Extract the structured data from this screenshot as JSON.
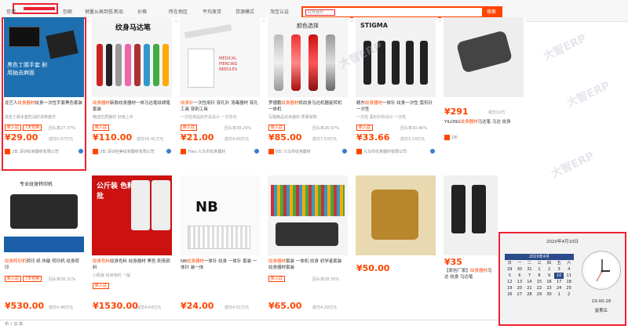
{
  "filters": {
    "items": [
      "信用",
      "包邮",
      "销量从高到低",
      "新品",
      "价格",
      "所在地区",
      "平均发货",
      "货源模式",
      "淘宝认证"
    ],
    "search_placeholder": "纹身器材",
    "search_button": "搜索"
  },
  "products": [
    {
      "title_a": "龙艺人",
      "title_hl": "纹身器材",
      "title_b": "纹身一次性手套黑色套装",
      "sub": "黑色丁腈手套防油防渗牌套件",
      "tags": [
        "新入驻",
        "7天包换"
      ],
      "rate": "回头率27.37%",
      "price": "¥29.00",
      "sold": "成交5.97万元",
      "shop": "2年 深圳纹身器材有限公司",
      "thumb_text": "黑色丁腈手套 耐用抽去麻面"
    },
    {
      "title_a": "",
      "title_hl": "纹身器材",
      "title_b": "新款纹身器材一体马达笔纹绣笔 套装",
      "sub": "精选优质器材 好用上手",
      "tags": [
        "新入驻"
      ],
      "rate": "",
      "price": "¥110.00",
      "sold": "成交16.41万元",
      "shop": "3年 深圳佳美纹身器材有限公司",
      "thumb_text": "纹身马达笔"
    },
    {
      "title_a": "",
      "title_hl": "纹身针",
      "title_b": "一次性用针 穿孔针 消毒器材 穿孔工具 穿刺工具",
      "sub": "一次性用品的开关设计 一次性也",
      "tags": [
        "新入驻"
      ],
      "rate": "回头率39.29%",
      "price": "¥21.00",
      "sold": "成交4.66万元",
      "shop": "Yiwu 义乌市纹身器材",
      "thumb_text": "MEDICAL PIERCING NEEDLES"
    },
    {
      "title_a": "罗德鹏",
      "title_hl": "纹身器材",
      "title_b": "机纹身马达机器旋转机 一体机",
      "sub": "写稿精品纹身器材 质量保障",
      "tags": [
        "新入驻"
      ],
      "rate": "回头率26.97%",
      "price": "¥85.00",
      "sold": "成交7.63万元",
      "shop": "8年 义乌市纹身器材",
      "thumb_text": "颜色选择"
    },
    {
      "title_a": "精东",
      "title_hl": "纹身器材",
      "title_b": "一体针 纹身一次性 弧形针 一次性",
      "sub": "一次性 弧形针的设计 一次性",
      "tags": [
        "新入驻"
      ],
      "rate": "回头率30.46%",
      "price": "¥33.66",
      "sold": "成交3.14万元",
      "shop": "义乌市纹身器材有限公司",
      "thumb_text": "STIGMA"
    },
    {
      "title_a": "YILONG",
      "title_hl": "纹身器材",
      "title_b": "马达笔 马达 纹身",
      "sub": "",
      "tags": [],
      "rate": "成交10万",
      "price": "¥291",
      "sold": "",
      "shop": "2年",
      "thumb_text": ""
    },
    {
      "title_a": "",
      "title_hl": "纹身转印机",
      "title_b": "转印 纸 热敏 转印机 纹身转印",
      "sub": "",
      "tags": [
        "新入驻",
        "7天包换"
      ],
      "rate": "回头率30.31%",
      "price": "¥530.00",
      "sold": "成交4.96万元",
      "shop": "",
      "thumb_text": "专业纹身转印机"
    },
    {
      "title_a": "",
      "title_hl": "纹身色料",
      "title_b": "纹身色料 纹身器材 黑色 刺青颜料",
      "sub": "小瓶装 纹身色料 一般",
      "tags": [
        "新入驻"
      ],
      "rate": "",
      "price": "¥1530.00",
      "sold": "成交4.64万元",
      "shop": "",
      "thumb_text": "公斤装 色料大批"
    },
    {
      "title_a": "NB",
      "title_hl": "纹身器材",
      "title_b": "一体针 纹身 一体针 套装 一体针 装一体",
      "sub": "",
      "tags": [],
      "rate": "",
      "price": "¥24.00",
      "sold": "成交4.51万元",
      "shop": "",
      "thumb_text": "NB"
    },
    {
      "title_a": "",
      "title_hl": "纹身器材",
      "title_b": "套装 一体机 纹身 初学者套装 纹身器材套装",
      "sub": "",
      "tags": [
        "新入驻"
      ],
      "rate": "回头率28.30%",
      "price": "¥65.00",
      "sold": "成交4.29万元",
      "shop": "",
      "thumb_text": ""
    },
    {
      "title_a": "",
      "title_hl": "",
      "title_b": "",
      "sub": "",
      "tags": [],
      "rate": "",
      "price": "¥50.00",
      "sold": "",
      "shop": "",
      "thumb_text": ""
    },
    {
      "title_a": "【原创厂家】",
      "title_hl": "纹身器材",
      "title_b": "马达 纹身 马达笔",
      "sub": "",
      "tags": [],
      "rate": "",
      "price": "¥35",
      "sold": "",
      "shop": "",
      "thumb_text": ""
    }
  ],
  "widget": {
    "date_full": "2020年4月10日",
    "cal_header": "2020年4月",
    "weekdays": [
      "日",
      "一",
      "二",
      "三",
      "四",
      "五",
      "六"
    ],
    "days": [
      "29",
      "30",
      "31",
      "1",
      "2",
      "3",
      "4",
      "5",
      "6",
      "7",
      "8",
      "9",
      "10",
      "11",
      "12",
      "13",
      "14",
      "15",
      "16",
      "17",
      "18",
      "19",
      "20",
      "21",
      "22",
      "23",
      "24",
      "25",
      "26",
      "27",
      "28",
      "29",
      "30",
      "1",
      "2"
    ],
    "time": "19:00:28",
    "weekday": "星期五"
  },
  "watermark": "大智ERP",
  "taskbar": {
    "text": "中 ♪ ☺ 关"
  }
}
